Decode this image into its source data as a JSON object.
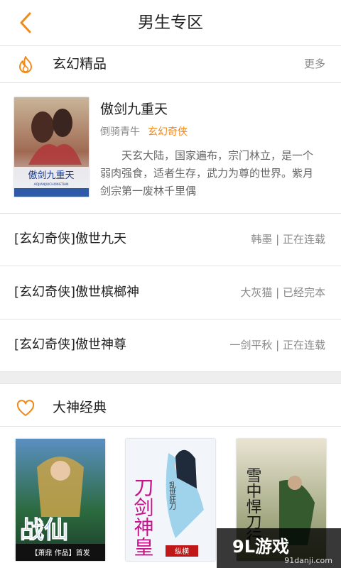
{
  "header": {
    "title": "男生专区"
  },
  "section1": {
    "title": "玄幻精品",
    "more_label": "更多",
    "featured": {
      "title": "傲剑九重天",
      "author": "倒骑青牛",
      "genre": "玄幻奇侠",
      "description": "天玄大陆，国家遍布，宗门林立，是一个弱肉强食，适者生存，武力为尊的世界。紫月剑宗第一废林千里偶",
      "cover_text": "傲剑九重天",
      "cover_subtext": "AOJIANJIUCHONGTIAN"
    },
    "list": [
      {
        "title": "[玄幻奇侠]傲世九天",
        "meta": "韩墨 | 正在连载"
      },
      {
        "title": "[玄幻奇侠]傲世槟榔神",
        "meta": "大灰猫 | 已经完本"
      },
      {
        "title": "[玄幻奇侠]傲世神尊",
        "meta": "一剑平秋 | 正在连载"
      }
    ]
  },
  "section2": {
    "title": "大神经典",
    "covers": [
      {
        "title": "战仙",
        "tagline": "【萧鼎 作品】首发"
      },
      {
        "title": "刀剑神皇",
        "tagline": "乱世狂刀",
        "badge": "纵横"
      },
      {
        "title": "雪中悍刀行",
        "tagline": ""
      }
    ]
  },
  "watermark": {
    "logo": "9L游戏",
    "url": "91danji.com"
  },
  "colors": {
    "accent": "#f08a1c",
    "divider": "#e3e3e3",
    "gap": "#eeeeee"
  }
}
